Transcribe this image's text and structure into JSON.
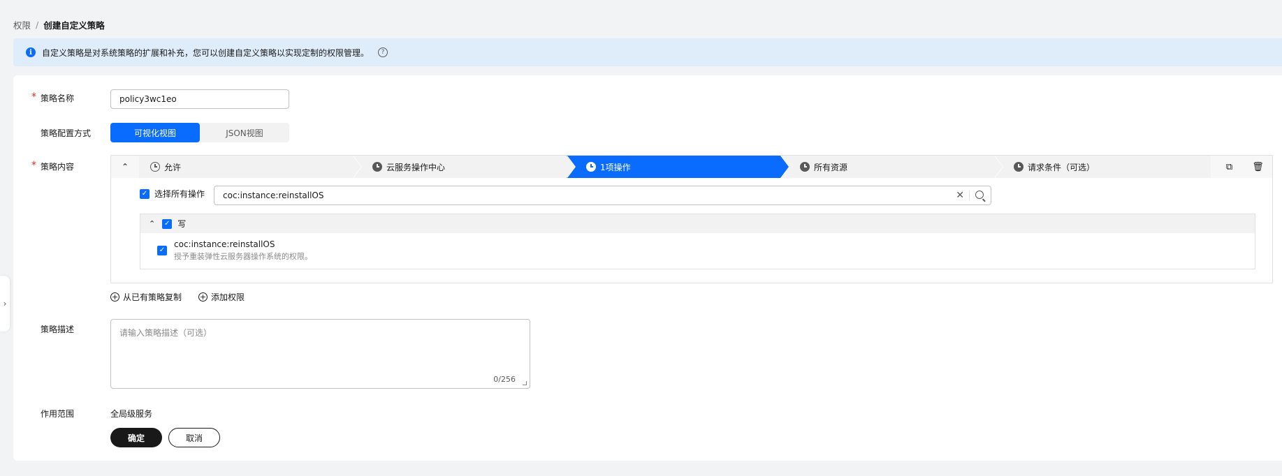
{
  "breadcrumb": {
    "parent": "权限",
    "separator": "/",
    "current": "创建自定义策略"
  },
  "notice": {
    "text": "自定义策略是对系统策略的扩展和补充，您可以创建自定义策略以实现定制的权限管理。",
    "help_glyph": "?"
  },
  "form": {
    "policy_name": {
      "label": "策略名称",
      "required_mark": "*",
      "value": "policy3wc1eo"
    },
    "config_mode": {
      "label": "策略配置方式",
      "options": [
        "可视化视图",
        "JSON视图"
      ],
      "selected": "可视化视图"
    },
    "policy_content": {
      "label": "策略内容",
      "required_mark": "*",
      "steps": [
        "允许",
        "云服务操作中心",
        "1项操作",
        "所有资源",
        "请求条件（可选）"
      ],
      "active_step": "1项操作",
      "select_all_label": "选择所有操作",
      "search_value": "coc:instance:reinstallOS",
      "group": {
        "name": "写",
        "items": [
          {
            "title": "coc:instance:reinstallOS",
            "desc": "授予重装弹性云服务器操作系统的权限。"
          }
        ]
      }
    },
    "actions": {
      "copy_from_existing": "从已有策略复制",
      "add_permission": "添加权限"
    },
    "description": {
      "label": "策略描述",
      "placeholder": "请输入策略描述（可选）",
      "counter": "0/256"
    },
    "scope": {
      "label": "作用范围",
      "value": "全局级服务"
    },
    "buttons": {
      "confirm": "确定",
      "cancel": "取消"
    }
  },
  "colors": {
    "accent": "#0a6cff",
    "primary_button": "#191919",
    "notice_bg": "#dfedfb",
    "required": "#e32a2a"
  }
}
